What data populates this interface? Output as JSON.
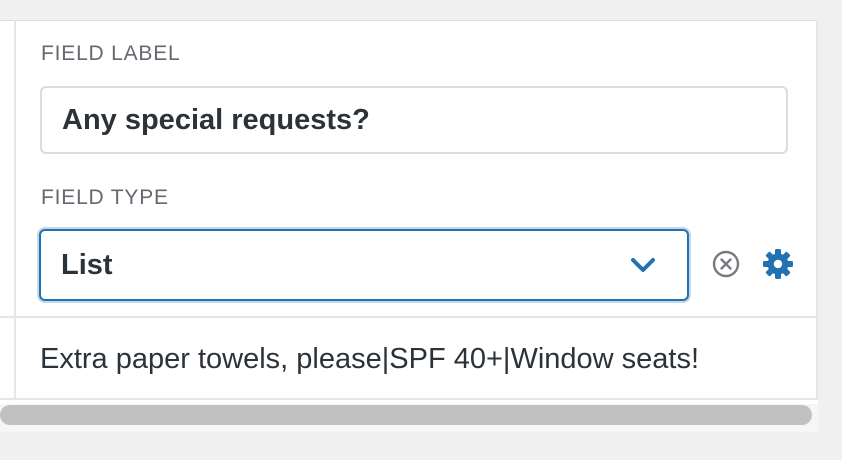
{
  "field_label": {
    "heading": "FIELD LABEL",
    "value": "Any special requests?"
  },
  "field_type": {
    "heading": "FIELD TYPE",
    "selected": "List"
  },
  "icons": {
    "select_arrow": "chevron-down-icon",
    "clear": "circle-x-icon",
    "settings": "gear-icon"
  },
  "options_row": {
    "text": "Extra paper towels, please|SPF 40+|Window seats!"
  },
  "colors": {
    "accent": "#2271b1",
    "focus_ring": "#c5d9ed",
    "label_text": "#646970",
    "body_text": "#2c3338",
    "border": "#dcdcde",
    "icon_gray": "#787c82"
  }
}
